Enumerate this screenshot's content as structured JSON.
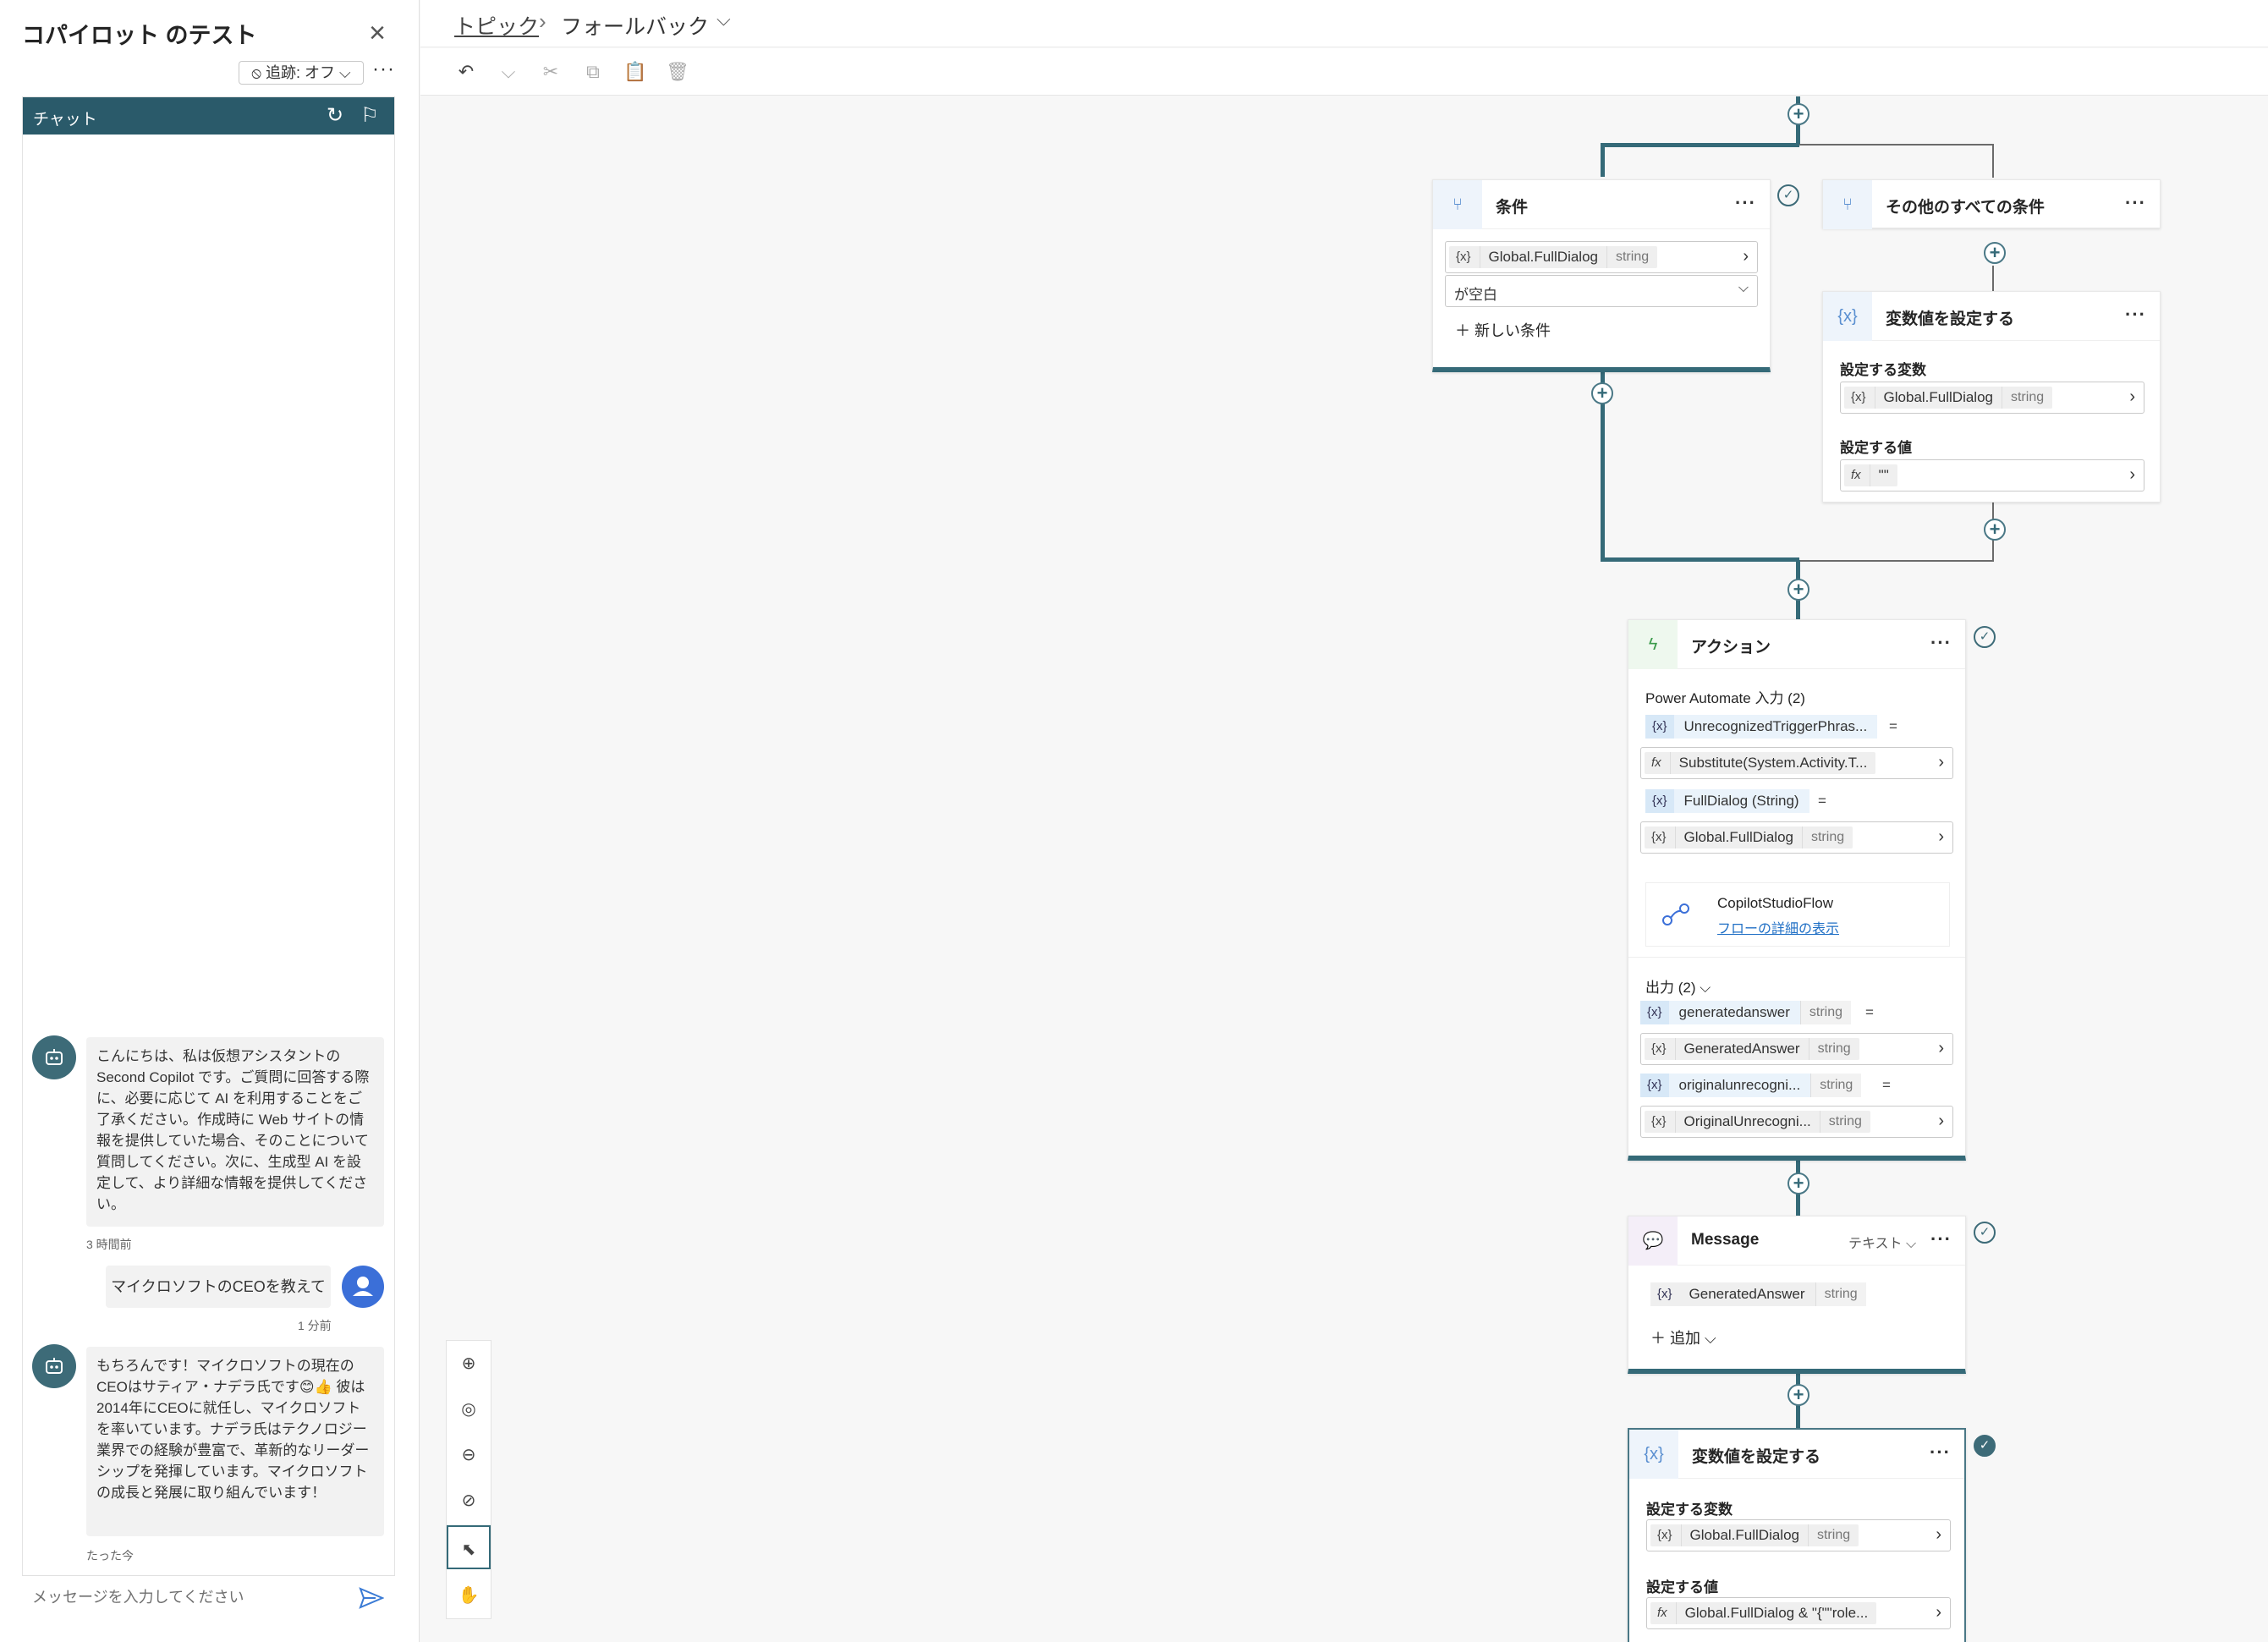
{
  "test_pane": {
    "title": "コパイロット のテスト",
    "tracking": "⦸ 追跡: オフ ⌵",
    "chat_label": "チャット",
    "messages": [
      {
        "text": "こんにちは、私は仮想アシスタントの Second Copilot です。ご質問に回答する際に、必要に応じて AI を利用することをご了承ください。作成時に Web サイトの情報を提供していた場合、そのことについて質問してください。次に、生成型 AI を設定して、より詳細な情報を提供してください。",
        "time": "3 時間前"
      },
      {
        "text": "マイクロソフトのCEOを教えて",
        "time": "1 分前"
      },
      {
        "text": "もちろんです！マイクロソフトの現在のCEOはサティア・ナデラ氏です😊👍 彼は2014年にCEOに就任し、マイクロソフトを率いています。ナデラ氏はテクノロジー業界での経験が豊富で、革新的なリーダーシップを発揮しています。マイクロソフトの成長と発展に取り組んでいます！",
        "time": "たった今"
      }
    ],
    "input_placeholder": "メッセージを入力してください"
  },
  "breadcrumb": {
    "topic": "トピック",
    "current": "フォールバック"
  },
  "nodes": {
    "condition": {
      "title": "条件",
      "var": "Global.FullDialog",
      "type": "string",
      "operator": "が空白",
      "new_condition": "新しい条件"
    },
    "else": {
      "title": "その他のすべての条件"
    },
    "setvar1": {
      "title": "変数値を設定する",
      "var_label": "設定する変数",
      "var": "Global.FullDialog",
      "type": "string",
      "val_label": "設定する値",
      "val": "\"\""
    },
    "action": {
      "title": "アクション",
      "inputs_label": "Power Automate 入力 (2)",
      "in1_name": "UnrecognizedTriggerPhras...",
      "in1_val": "Substitute(System.Activity.T...",
      "in2_name": "FullDialog (String)",
      "in2_val": "Global.FullDialog",
      "in2_type": "string",
      "flow_name": "CopilotStudioFlow",
      "flow_link": "フローの詳細の表示",
      "outputs_label": "出力 (2)",
      "out1_name": "generatedanswer",
      "out1_type": "string",
      "out1_val": "GeneratedAnswer",
      "out1_vtype": "string",
      "out2_name": "originalunrecogni...",
      "out2_type": "string",
      "out2_val": "OriginalUnrecogni...",
      "out2_vtype": "string"
    },
    "message": {
      "title": "Message",
      "mode": "テキスト",
      "var": "GeneratedAnswer",
      "type": "string",
      "add": "追加"
    },
    "setvar2": {
      "title": "変数値を設定する",
      "var_label": "設定する変数",
      "var": "Global.FullDialog",
      "type": "string",
      "val_label": "設定する値",
      "val": "Global.FullDialog & \"{\"\"role..."
    }
  },
  "colors": {
    "accent": "#356a78",
    "header": "#2a5a6a",
    "user_avatar": "#3b6fd8"
  }
}
